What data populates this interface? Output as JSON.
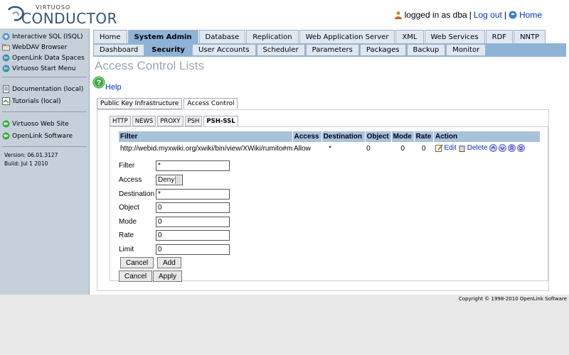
{
  "header": {
    "logo_small": "VIRTUOSO",
    "logo_big": "CONDUCTOR",
    "logged_in_text": "logged in as dba",
    "sep1": "|",
    "logout_label": "Log out",
    "sep2": "|",
    "home_label": "Home"
  },
  "sidebar": {
    "group1": [
      {
        "label": "Interactive SQL (ISQL)",
        "icon": "db-icon"
      },
      {
        "label": "WebDAV Browser",
        "icon": "folder-icon"
      },
      {
        "label": "OpenLink Data Spaces",
        "icon": "globe-icon"
      },
      {
        "label": "Virtuoso Start Menu",
        "icon": "globe-icon"
      }
    ],
    "group2": [
      {
        "label": "Documentation (local)",
        "icon": "doc-icon"
      },
      {
        "label": "Tutorials (local)",
        "icon": "tutorial-icon"
      }
    ],
    "group3": [
      {
        "label": "Virtuoso Web Site",
        "icon": "globe-icon"
      },
      {
        "label": "OpenLink Software",
        "icon": "globe-icon"
      }
    ],
    "version": "Version: 06.01.3127",
    "build": "Build: Jul 1 2010"
  },
  "nav": {
    "tabs": [
      "Home",
      "System Admin",
      "Database",
      "Replication",
      "Web Application Server",
      "XML",
      "Web Services",
      "RDF",
      "NNTP"
    ],
    "subtabs": [
      "Dashboard",
      "Security",
      "User Accounts",
      "Scheduler",
      "Parameters",
      "Packages",
      "Backup",
      "Monitor"
    ]
  },
  "page": {
    "title": "Access Control Lists",
    "help_label": "Help"
  },
  "tabs": {
    "level1": [
      "Public Key Infrastructure",
      "Access Control"
    ],
    "level2": [
      "HTTP",
      "NEWS",
      "PROXY",
      "PSH",
      "PSH-SSL"
    ]
  },
  "table": {
    "headers": [
      "Filter",
      "Access",
      "Destination",
      "Object",
      "Mode",
      "Rate",
      "Action"
    ],
    "row": {
      "filter": "http://webid.myxwiki.org/xwiki/bin/view/XWiki/rumito#me",
      "access": "Allow",
      "destination": "*",
      "object": "0",
      "mode": "0",
      "rate": "0",
      "edit": "Edit",
      "delete": "Delete"
    }
  },
  "form": {
    "filter_label": "Filter",
    "filter_value": "*",
    "access_label": "Access",
    "access_value": "Deny",
    "destination_label": "Destination",
    "destination_value": "*",
    "object_label": "Object",
    "object_value": "0",
    "mode_label": "Mode",
    "mode_value": "0",
    "rate_label": "Rate",
    "rate_value": "0",
    "limit_label": "Limit",
    "limit_value": "0",
    "cancel_label": "Cancel",
    "add_label": "Add",
    "cancel2_label": "Cancel",
    "apply_label": "Apply"
  },
  "footer": {
    "copyright": "Copyright © 1998-2010 OpenLink Software"
  },
  "colors": {
    "nav_active": "#8fb3d6",
    "sidebar_bg": "#c6d0da",
    "table_header": "#a9c2dc",
    "link": "#0033cc"
  }
}
